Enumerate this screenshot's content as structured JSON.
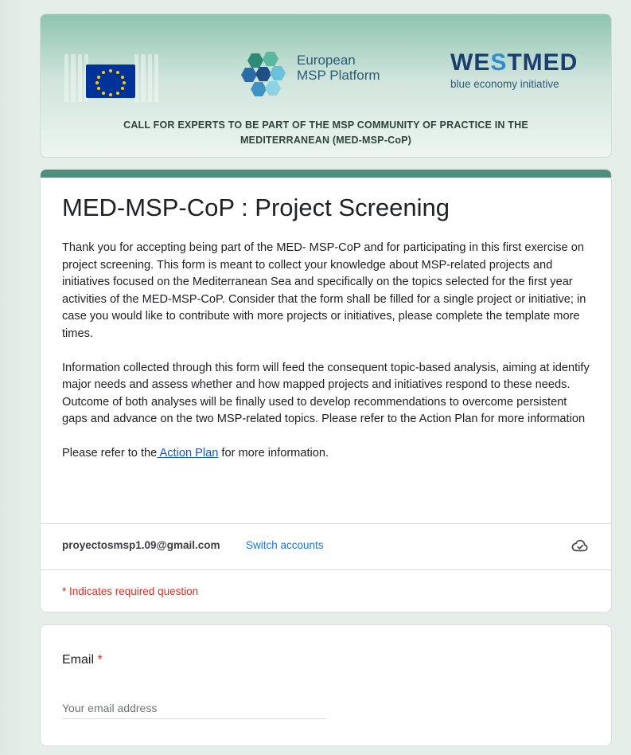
{
  "banner": {
    "msp_logo_line1": "European",
    "msp_logo_line2": "MSP Platform",
    "westmed_logo": "WESTMED",
    "westmed_tagline": "blue economy initiative",
    "call_line1": "CALL FOR EXPERTS TO BE PART OF THE MSP COMMUNITY OF PRACTICE IN THE",
    "call_line2": "MEDITERRANEAN (MED-MSP-CoP)"
  },
  "form": {
    "title": "MED-MSP-CoP : Project Screening",
    "paragraph1": "Thank you for accepting being part of the MED- MSP-CoP and for participating in this first exercise on project screening. This form is meant to collect your knowledge about MSP-related projects and initiatives focused on the Mediterranean Sea and specifically on the topics selected for the first year activities of the MED-MSP-CoP. Consider that the form shall be filled for a single project or initiative; in case you would like to contribute with more projects or initiatives, please complete the template more times.",
    "paragraph2": "Information collected through this form will feed the consequent topic-based analysis, aiming at identify major needs and assess whether and how mapped projects and initiatives respond to these needs. Outcome of both analyses will be finally used to develop recommendations to overcome persistent gaps and advance on the two MSP-related topics. Please refer to the Action Plan for more information",
    "paragraph3_prefix": " Please refer to the",
    "action_plan_link": " Action Plan",
    "paragraph3_suffix": " for more information."
  },
  "account": {
    "email": "proyectosmsp1.09@gmail.com",
    "switch_label": "Switch accounts",
    "icon": "cloud-check-icon"
  },
  "required_note": "* Indicates required question",
  "questions": {
    "email": {
      "label": "Email",
      "required_marker": "*",
      "placeholder": "Your email address",
      "value": ""
    }
  },
  "colors": {
    "accent": "#4c8f7b",
    "background": "#e6eeea",
    "required": "#d93025",
    "link": "#1a73e8"
  }
}
